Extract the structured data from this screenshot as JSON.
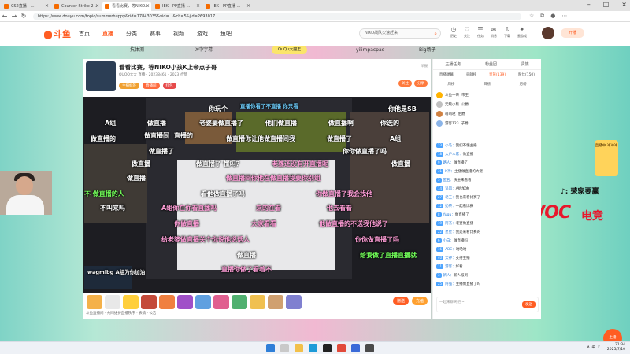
{
  "browser": {
    "tabs": [
      {
        "label": "CS2直播 - ...",
        "active": false
      },
      {
        "label": "Counter-Strike 2 ...",
        "active": false
      },
      {
        "label": "看看比赛，等NIKO...",
        "active": true
      },
      {
        "label": "IEK - PP直播 ...",
        "active": false
      },
      {
        "label": "IEK - PP直播 ...",
        "active": false
      }
    ],
    "url": "https://www.douyu.com/topic/summerhuppy&rid=17843035&vid=...&ch=5&jId=2693017..."
  },
  "site": {
    "logo_text": "斗鱼",
    "nav": [
      "首页",
      "直播",
      "分类",
      "赛事",
      "视频",
      "游戏",
      "鱼吧"
    ],
    "nav_active_index": 1,
    "search_placeholder": "NIKO战队火速赶来",
    "header_icons": [
      "历史",
      "关注",
      "任务",
      "消息",
      "下载",
      "云游戏"
    ],
    "open_button": "开播"
  },
  "banners": {
    "b1": "抗体测",
    "b2": "X中字幕",
    "b3": "QuQu大魔王",
    "b4": "yilimpacpao",
    "b5": "Big场子"
  },
  "room": {
    "title": "看看比赛，等NIKO小孩K上帝点子哥",
    "meta": "QUOQ大大 直播 · 20238461 · 2023 点赞",
    "tags": [
      "主播标签",
      "直播间",
      "红包"
    ],
    "right_tags": [
      "关注",
      "分享"
    ],
    "report": "举报"
  },
  "danmaku": [
    {
      "text": "你玩个",
      "cls": ""
    },
    {
      "text": "你他是SB",
      "cls": ""
    },
    {
      "text": "直播你看了不直播 你只看",
      "cls": "blue small"
    },
    {
      "text": "A组",
      "cls": ""
    },
    {
      "text": "做直播",
      "cls": ""
    },
    {
      "text": "老婆要做直播了",
      "cls": ""
    },
    {
      "text": "他们做直播",
      "cls": ""
    },
    {
      "text": "做直播啊",
      "cls": ""
    },
    {
      "text": "你选的",
      "cls": ""
    },
    {
      "text": "做直播间",
      "cls": ""
    },
    {
      "text": "直播的",
      "cls": ""
    },
    {
      "text": "做直播的",
      "cls": ""
    },
    {
      "text": "A组",
      "cls": ""
    },
    {
      "text": "做直播你让他做直播间我",
      "cls": ""
    },
    {
      "text": "做直播了",
      "cls": ""
    },
    {
      "text": "做直播了",
      "cls": ""
    },
    {
      "text": "你你做直播了吗",
      "cls": ""
    },
    {
      "text": "做直播",
      "cls": ""
    },
    {
      "text": "做直播",
      "cls": ""
    },
    {
      "text": "做直播了 懂吗？",
      "cls": ""
    },
    {
      "text": "老婆还没有开直播呢",
      "cls": "pink"
    },
    {
      "text": "做直播",
      "cls": ""
    },
    {
      "text": "做直播间你他在做直播我要你别组",
      "cls": "pink"
    },
    {
      "text": "不 做直播的人",
      "cls": "green"
    },
    {
      "text": "看他做直播了吗",
      "cls": ""
    },
    {
      "text": "你做直播了我会找他",
      "cls": "pink"
    },
    {
      "text": "不叫来吗",
      "cls": ""
    },
    {
      "text": "A组你在你看直播吗",
      "cls": "pink"
    },
    {
      "text": "来的在看",
      "cls": "pink"
    },
    {
      "text": "他去看看",
      "cls": "pink"
    },
    {
      "text": "你做直播",
      "cls": "pink"
    },
    {
      "text": "大家看看",
      "cls": "pink"
    },
    {
      "text": "他做直播的不送我他说了",
      "cls": "pink"
    },
    {
      "text": "给老婆做直播关个你说他说话人",
      "cls": "pink"
    },
    {
      "text": "你你做直播了吗",
      "cls": "pink"
    },
    {
      "text": "做直播",
      "cls": ""
    },
    {
      "text": "给我做了直播直播就",
      "cls": "green"
    },
    {
      "text": "直播你做了看着不",
      "cls": "pink"
    }
  ],
  "webcam_caption": "wagmlbg\nA组为你加油",
  "controls": {
    "bottom_left": "斗鱼直播间 · 共同维护直播秩序 · 表情 · 公告",
    "buttons": [
      "赠送",
      "充值"
    ]
  },
  "chat": {
    "top": [
      "主播任务",
      "粉丝团",
      "贵族"
    ],
    "tabs": [
      "直播弹幕",
      "贡献榜",
      "贵族(139)",
      "粉丝(150)"
    ],
    "active_tab_index": 2,
    "tabs2": [
      "周榜",
      "日榜",
      "月榜"
    ],
    "ranks": [
      {
        "name": "斗鱼一哥",
        "value": "帝王"
      },
      {
        "name": "无敌小熊",
        "value": "公爵"
      },
      {
        "name": "萌萌哒",
        "value": "伯爵"
      },
      {
        "name": "游客123",
        "value": "子爵"
      }
    ],
    "messages": [
      {
        "lv": "23",
        "user": "小马：",
        "text": "我们不懂主播"
      },
      {
        "lv": "18",
        "user": "大户人家：",
        "text": "做直播"
      },
      {
        "lv": "9",
        "user": "路人：",
        "text": "做直播了"
      },
      {
        "lv": "31",
        "user": "K神：",
        "text": "主播做直播的大佬"
      },
      {
        "lv": "5",
        "user": "匿名：",
        "text": "快进来看看"
      },
      {
        "lv": "14",
        "user": "追风：",
        "text": "A组加油"
      },
      {
        "lv": "27",
        "user": "老王：",
        "text": "我也来看比赛了"
      },
      {
        "lv": "12",
        "user": "奶茶：",
        "text": "一起看比赛"
      },
      {
        "lv": "8",
        "user": "Yuqu：",
        "text": "做直播了"
      },
      {
        "lv": "19",
        "user": "阿杰：",
        "text": "老婆做直播"
      },
      {
        "lv": "22",
        "user": "星星：",
        "text": "我是来看比赛的"
      },
      {
        "lv": "6",
        "user": "小白：",
        "text": "做直播吗"
      },
      {
        "lv": "16",
        "user": "ABC：",
        "text": "哈哈哈"
      },
      {
        "lv": "40",
        "user": "大神：",
        "text": "支持主播"
      },
      {
        "lv": "11",
        "user": "游客：",
        "text": "好看"
      },
      {
        "lv": "3",
        "user": "新人：",
        "text": "新人报到"
      },
      {
        "lv": "25",
        "user": "阿强：",
        "text": "主播做直播了吗"
      }
    ],
    "input_placeholder": "一起来聊天吧～",
    "send_label": "发送"
  },
  "decor": {
    "tiktok": "♪: 荣家要赢",
    "woc": "WOC",
    "woc_sub": "电竞",
    "side_badge": "直播中 冲冲冲",
    "fab": "主播"
  },
  "taskbar": {
    "time": "21:34",
    "date": "2025/7/10"
  }
}
